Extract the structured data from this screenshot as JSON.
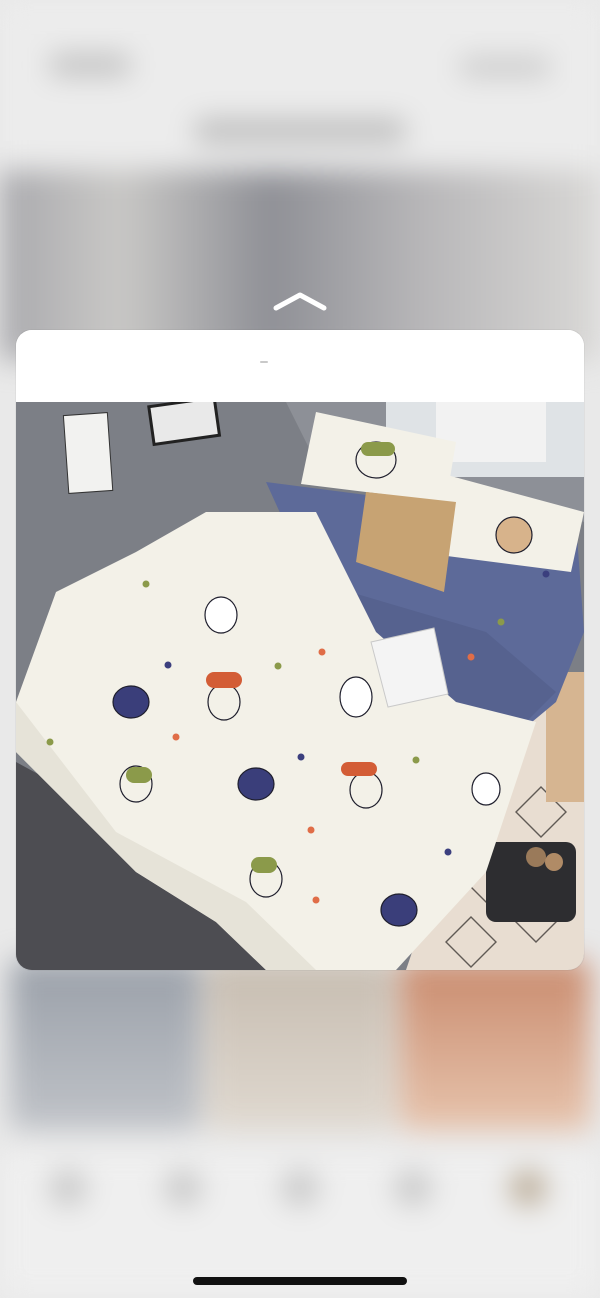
{
  "background": {
    "description_label": "",
    "bottom_tabs": [
      "",
      "",
      "",
      "",
      ""
    ]
  },
  "preview": {
    "chevron_icon": "chevron-up-icon",
    "header_text": "",
    "image_subject": "bedding-set-with-cartoon-dogs"
  },
  "colors": {
    "card_background": "#ffffff",
    "duvet": "#f3f1e8",
    "sheet_blue": "#5d6a99",
    "pillow_tan": "#c7a373",
    "floor": "#4d4d52",
    "wall": "#7c7f86"
  }
}
